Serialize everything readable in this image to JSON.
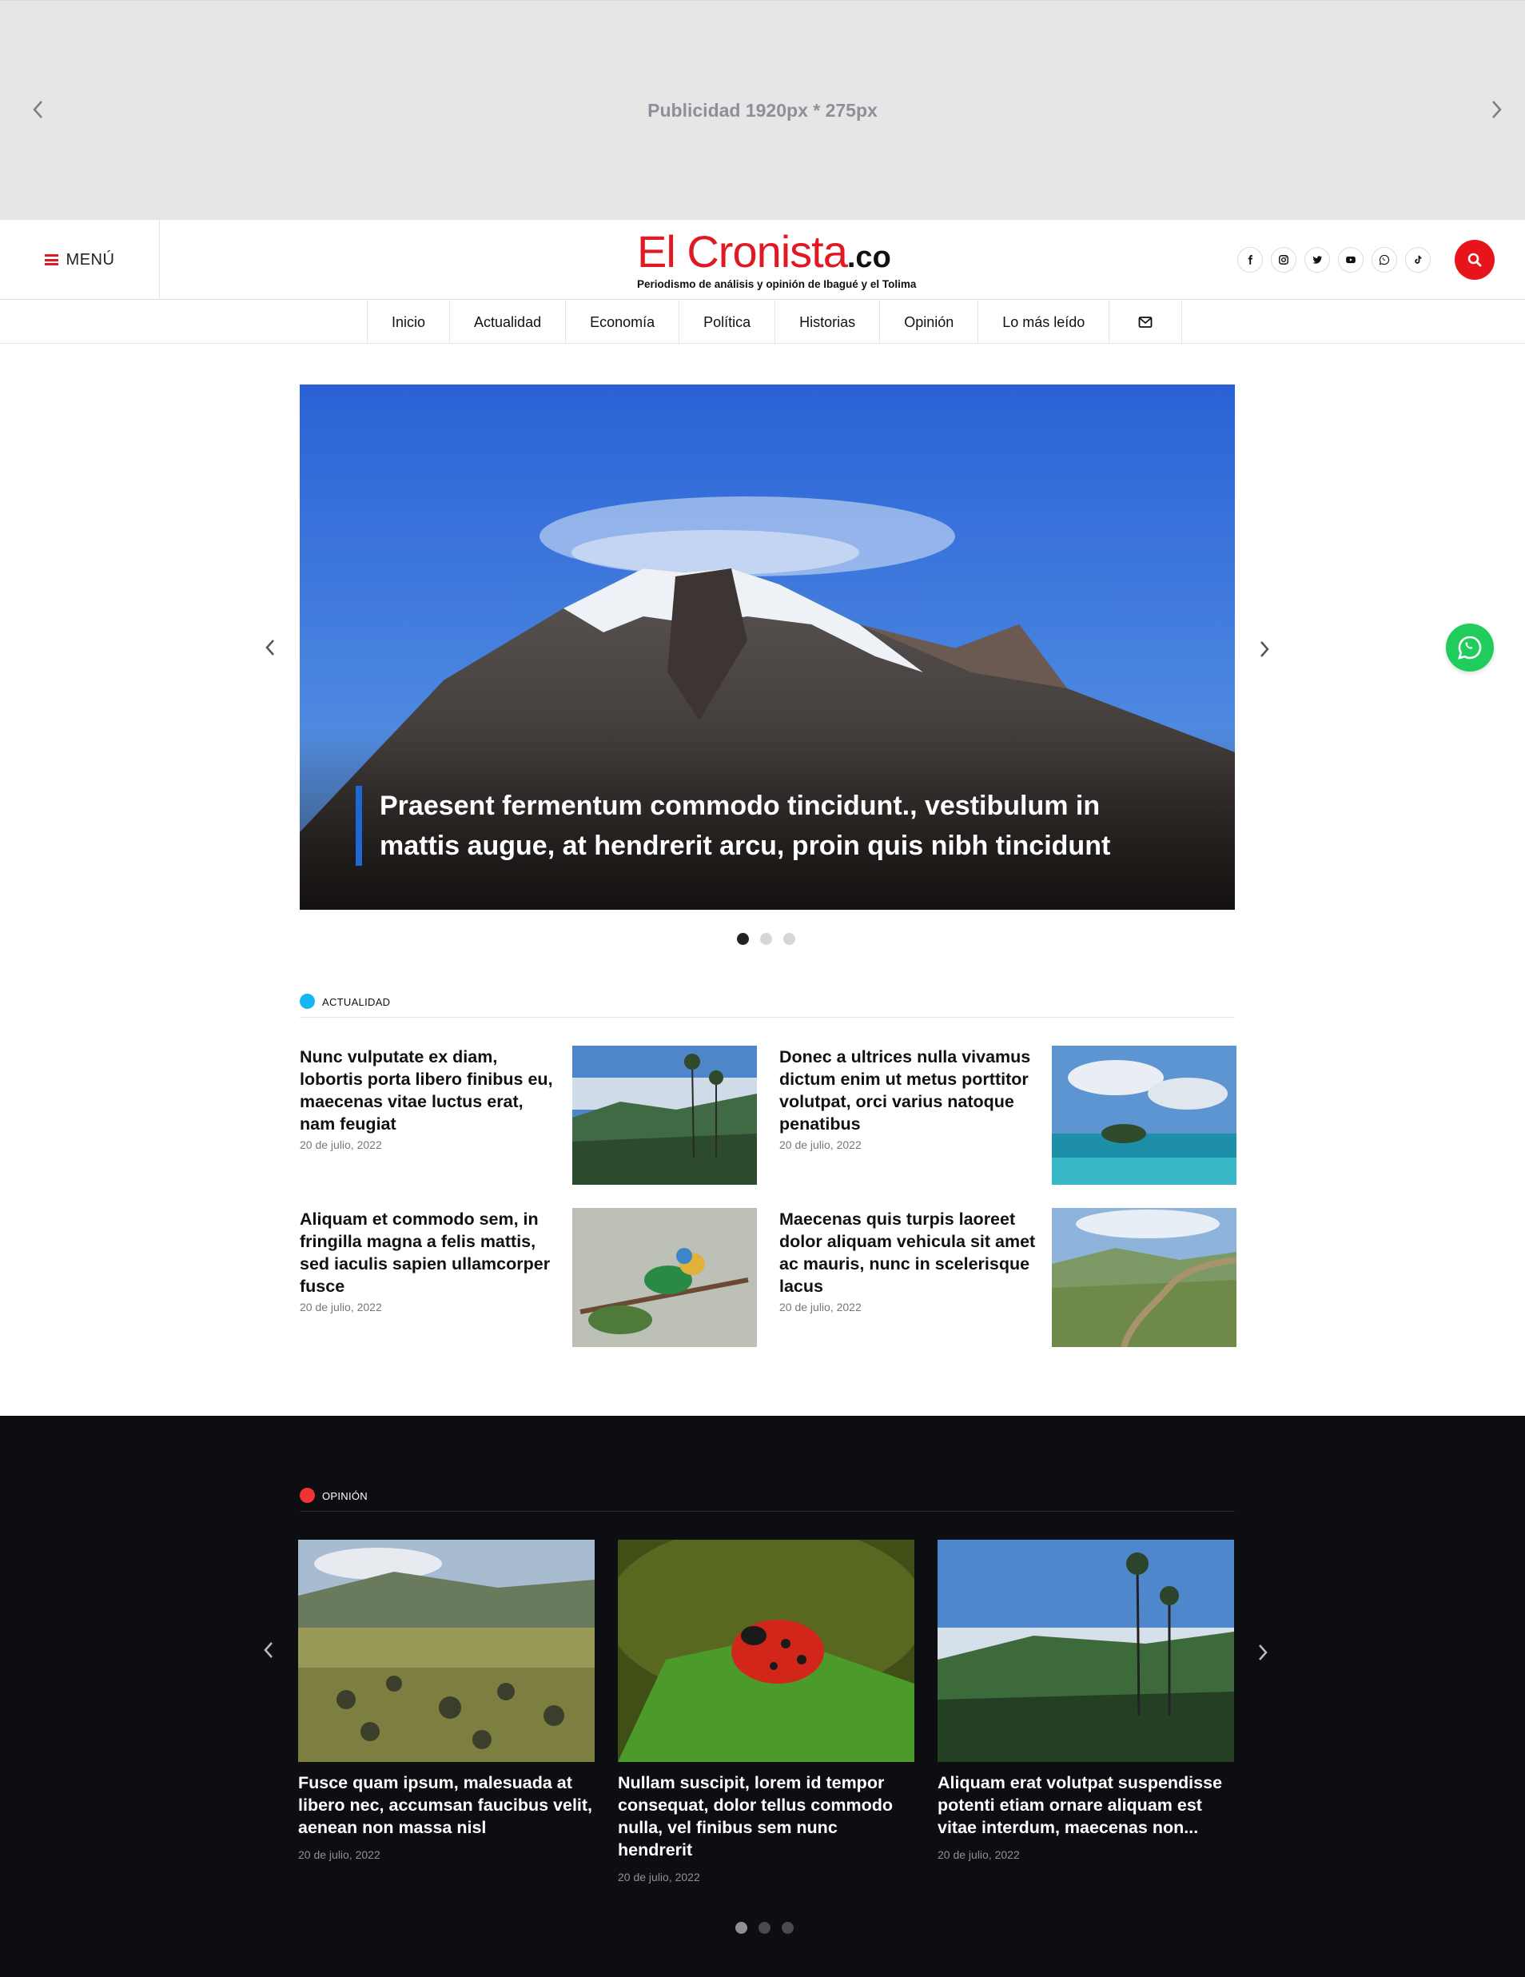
{
  "ad_banner": {
    "text": "Publicidad 1920px * 275px"
  },
  "header": {
    "menu_label": "MENÚ",
    "logo_name": "El Cronista",
    "logo_tld": ".co",
    "logo_tagline": "Periodismo de análisis y opinión de Ibagué y el Tolima",
    "social_icons": [
      "facebook-icon",
      "instagram-icon",
      "twitter-icon",
      "youtube-icon",
      "whatsapp-icon",
      "tiktok-icon"
    ],
    "accent_color": "#e01a22"
  },
  "nav": {
    "items": [
      "Inicio",
      "Actualidad",
      "Economía",
      "Política",
      "Historias",
      "Opinión",
      "Lo más leído"
    ]
  },
  "hero": {
    "title": "Praesent fermentum commodo tincidunt., vestibulum in mattis augue, at hendrerit arcu, proin quis nibh tincidunt",
    "accent_color": "#1d67d6"
  },
  "actualidad": {
    "label": "ACTUALIDAD",
    "color": "#16b7f1",
    "articles": [
      {
        "title": "Nunc vulputate ex diam, lobortis porta libero finibus eu, maecenas vitae luctus erat, nam feugiat",
        "date": "20 de julio, 2022",
        "image": "wax-palm-valley"
      },
      {
        "title": "Donec a ultrices nulla vivamus dictum enim ut metus porttitor volutpat, orci varius natoque penatibus",
        "date": "20 de julio, 2022",
        "image": "caribbean-island"
      },
      {
        "title": "Aliquam et commodo sem, in fringilla magna a felis mattis, sed iaculis sapien ullamcorper fusce",
        "date": "20 de julio, 2022",
        "image": "macaw-parrot"
      },
      {
        "title": "Maecenas quis turpis laoreet dolor aliquam vehicula sit amet ac mauris, nunc in scelerisque lacus",
        "date": "20 de julio, 2022",
        "image": "river-valley"
      }
    ]
  },
  "opinion": {
    "label": "OPINIÓN",
    "color": "#f03434",
    "articles": [
      {
        "title": "Fusce quam ipsum, malesuada at libero nec, accumsan faucibus velit, aenean non massa nisl",
        "date": "20 de julio, 2022",
        "image": "paramo-frailejones"
      },
      {
        "title": "Nullam suscipit, lorem id tempor consequat, dolor tellus commodo nulla, vel finibus sem nunc hendrerit",
        "date": "20 de julio, 2022",
        "image": "ladybug-leaf"
      },
      {
        "title": "Aliquam erat volutpat suspendisse potenti etiam ornare aliquam est vitae interdum, maecenas non...",
        "date": "20 de julio, 2022",
        "image": "wax-palm-valley"
      }
    ]
  }
}
